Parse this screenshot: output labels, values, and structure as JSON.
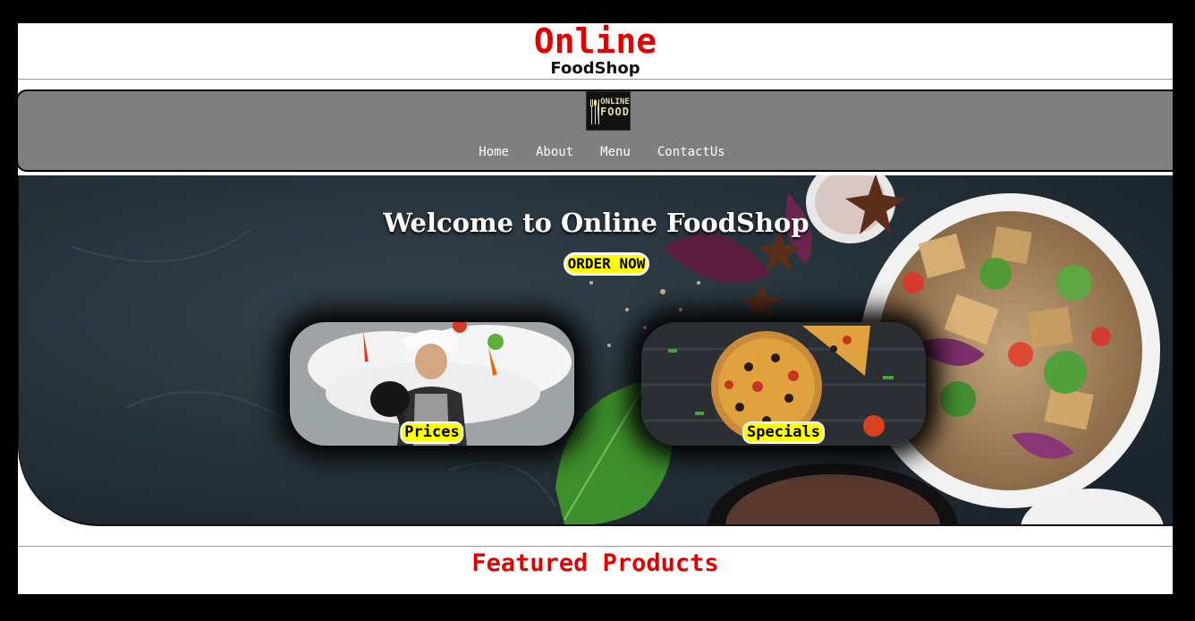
{
  "header": {
    "title": "Online",
    "subtitle": "FoodShop"
  },
  "navbar": {
    "logo": {
      "line1": "ONLINE",
      "line2": "FOOD",
      "icon": "fork-spoon-knife-icon"
    },
    "links": [
      "Home",
      "About",
      "Menu",
      "ContactUs"
    ]
  },
  "hero": {
    "title": "Welcome to Online FoodShop",
    "cta_label": "ORDER NOW",
    "cards": [
      {
        "label": "Prices"
      },
      {
        "label": "Specials"
      }
    ]
  },
  "featured": {
    "title": "Featured Products"
  },
  "colors": {
    "brand_red": "#e10000",
    "nav_bg": "#7f7f7f",
    "highlight_yellow": "#ffff00"
  }
}
